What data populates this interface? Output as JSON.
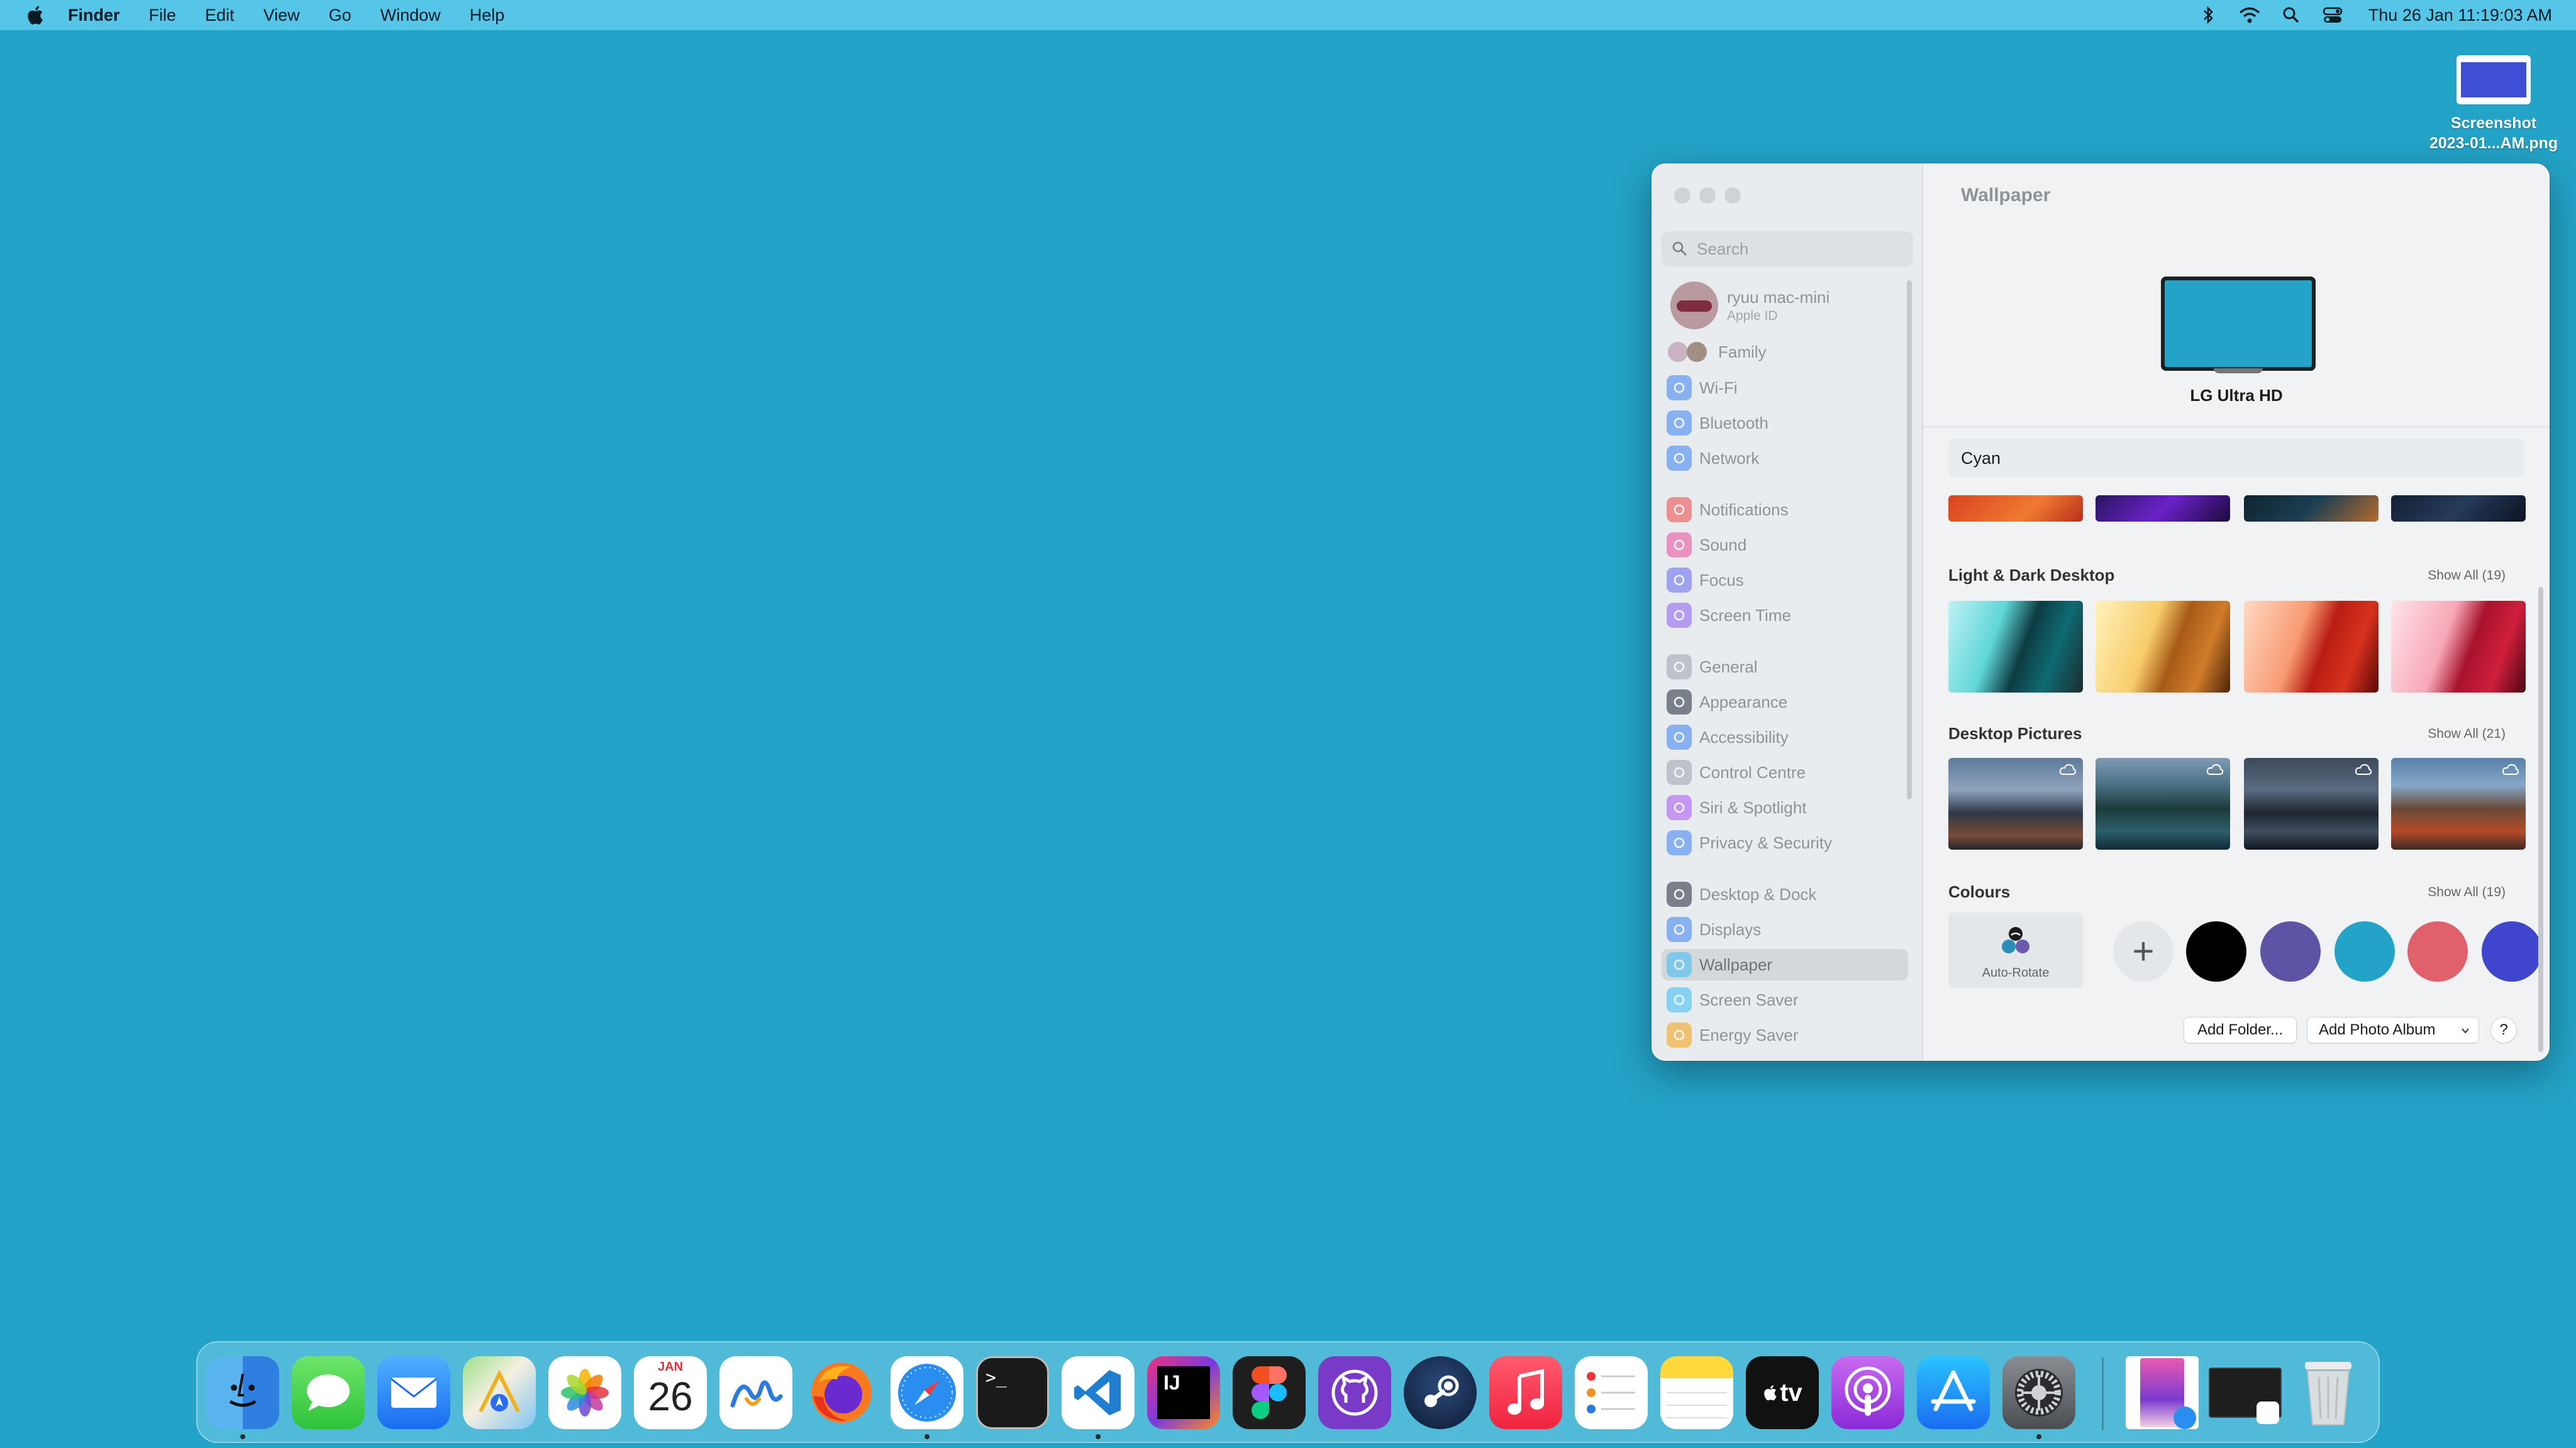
{
  "menubar": {
    "app_name": "Finder",
    "menus": [
      "File",
      "Edit",
      "View",
      "Go",
      "Window",
      "Help"
    ],
    "clock": "Thu 26 Jan  11:19:03 AM",
    "status_icons": [
      "bluetooth-icon",
      "wifi-icon",
      "search-icon",
      "control-centre-icon"
    ]
  },
  "desktop": {
    "background_color": "#23a3c8",
    "files": [
      {
        "name_line1": "Screenshot",
        "name_line2": "2023-01...AM.png"
      }
    ]
  },
  "settings": {
    "search_placeholder": "Search",
    "account": {
      "name": "ryuu mac-mini",
      "subtitle": "Apple ID"
    },
    "family_label": "Family",
    "sidebar_items": [
      {
        "label": "Wi-Fi",
        "icon": "wifi-icon",
        "color": "#3b82f6"
      },
      {
        "label": "Bluetooth",
        "icon": "bluetooth-icon",
        "color": "#3b82f6"
      },
      {
        "label": "Network",
        "icon": "globe-icon",
        "color": "#3b82f6"
      },
      {
        "label": "Notifications",
        "icon": "bell-icon",
        "color": "#ef4444"
      },
      {
        "label": "Sound",
        "icon": "speaker-icon",
        "color": "#ec4899"
      },
      {
        "label": "Focus",
        "icon": "moon-icon",
        "color": "#6366f1"
      },
      {
        "label": "Screen Time",
        "icon": "hourglass-icon",
        "color": "#8b5cf6"
      },
      {
        "label": "General",
        "icon": "gear-icon",
        "color": "#9ca3af"
      },
      {
        "label": "Appearance",
        "icon": "appearance-icon",
        "color": "#1f2937"
      },
      {
        "label": "Accessibility",
        "icon": "accessibility-icon",
        "color": "#3b82f6"
      },
      {
        "label": "Control Centre",
        "icon": "control-centre-icon",
        "color": "#9ca3af"
      },
      {
        "label": "Siri & Spotlight",
        "icon": "siri-icon",
        "color": "#a855f7"
      },
      {
        "label": "Privacy & Security",
        "icon": "hand-icon",
        "color": "#3b82f6"
      },
      {
        "label": "Desktop & Dock",
        "icon": "dock-icon",
        "color": "#1f2937"
      },
      {
        "label": "Displays",
        "icon": "sun-icon",
        "color": "#3b82f6"
      },
      {
        "label": "Wallpaper",
        "icon": "wallpaper-icon",
        "color": "#38bdf8",
        "selected": true
      },
      {
        "label": "Screen Saver",
        "icon": "screen-saver-icon",
        "color": "#38bdf8"
      },
      {
        "label": "Energy Saver",
        "icon": "bulb-icon",
        "color": "#f59e0b"
      }
    ],
    "pane": {
      "title": "Wallpaper",
      "display_name": "LG Ultra HD",
      "current_wallpaper": "Cyan",
      "sections": [
        {
          "title": "Light & Dark Desktop",
          "show_all": "Show All (19)"
        },
        {
          "title": "Desktop Pictures",
          "show_all": "Show All (21)"
        },
        {
          "title": "Colours",
          "show_all": "Show All (19)"
        }
      ],
      "auto_rotate_label": "Auto-Rotate",
      "colour_swatches": [
        "#000000",
        "#5e54a6",
        "#23a3c8",
        "#e0606b",
        "#3f45cc"
      ],
      "add_folder_label": "Add Folder...",
      "add_album_label": "Add Photo Album",
      "help_label": "?"
    }
  },
  "dock": {
    "apps": [
      {
        "name": "Finder",
        "running": true
      },
      {
        "name": "Messages",
        "running": false
      },
      {
        "name": "Mail",
        "running": false
      },
      {
        "name": "Maps",
        "running": false
      },
      {
        "name": "Photos",
        "running": false
      },
      {
        "name": "Calendar",
        "running": false,
        "month": "JAN",
        "day": "26"
      },
      {
        "name": "Freeform",
        "running": false
      },
      {
        "name": "Firefox",
        "running": false
      },
      {
        "name": "Safari",
        "running": true
      },
      {
        "name": "Terminal",
        "running": false
      },
      {
        "name": "Visual Studio Code",
        "running": true
      },
      {
        "name": "IntelliJ IDEA",
        "running": false
      },
      {
        "name": "Figma",
        "running": false
      },
      {
        "name": "GitHub Desktop",
        "running": false
      },
      {
        "name": "Steam",
        "running": false
      },
      {
        "name": "Music",
        "running": false
      },
      {
        "name": "Reminders",
        "running": false
      },
      {
        "name": "Notes",
        "running": false
      },
      {
        "name": "Apple TV",
        "running": false,
        "label": "tv"
      },
      {
        "name": "Podcasts",
        "running": false
      },
      {
        "name": "App Store",
        "running": false
      },
      {
        "name": "System Settings",
        "running": true
      }
    ],
    "terminal_prompt": ">_",
    "intellij_label": "IJ"
  }
}
